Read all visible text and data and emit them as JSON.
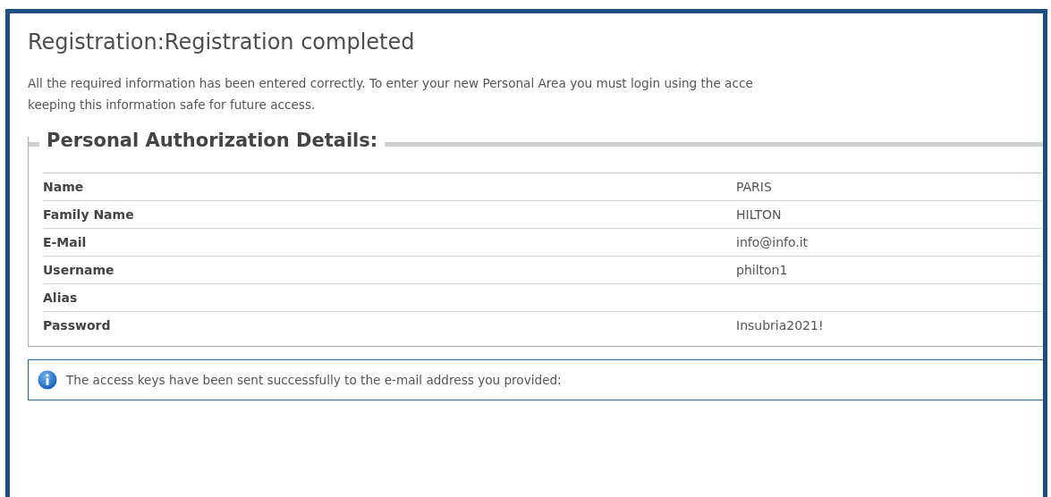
{
  "heading": "Registration:Registration completed",
  "message": "All the required information has been entered correctly. To enter your new Personal Area you must login using the acce\nkeeping this information safe for future access.",
  "details": {
    "legend": "Personal Authorization Details:",
    "rows": [
      {
        "label": "Name",
        "value": "PARIS"
      },
      {
        "label": "Family Name",
        "value": "HILTON"
      },
      {
        "label": "E-Mail",
        "value": "info@info.it"
      },
      {
        "label": "Username",
        "value": "philton1"
      },
      {
        "label": "Alias"
      },
      {
        "label": "Password",
        "value": "Insubria2021!"
      }
    ]
  },
  "notice": {
    "kind": "info",
    "text": "The access keys have been sent successfully to the e-mail address you provided:"
  }
}
